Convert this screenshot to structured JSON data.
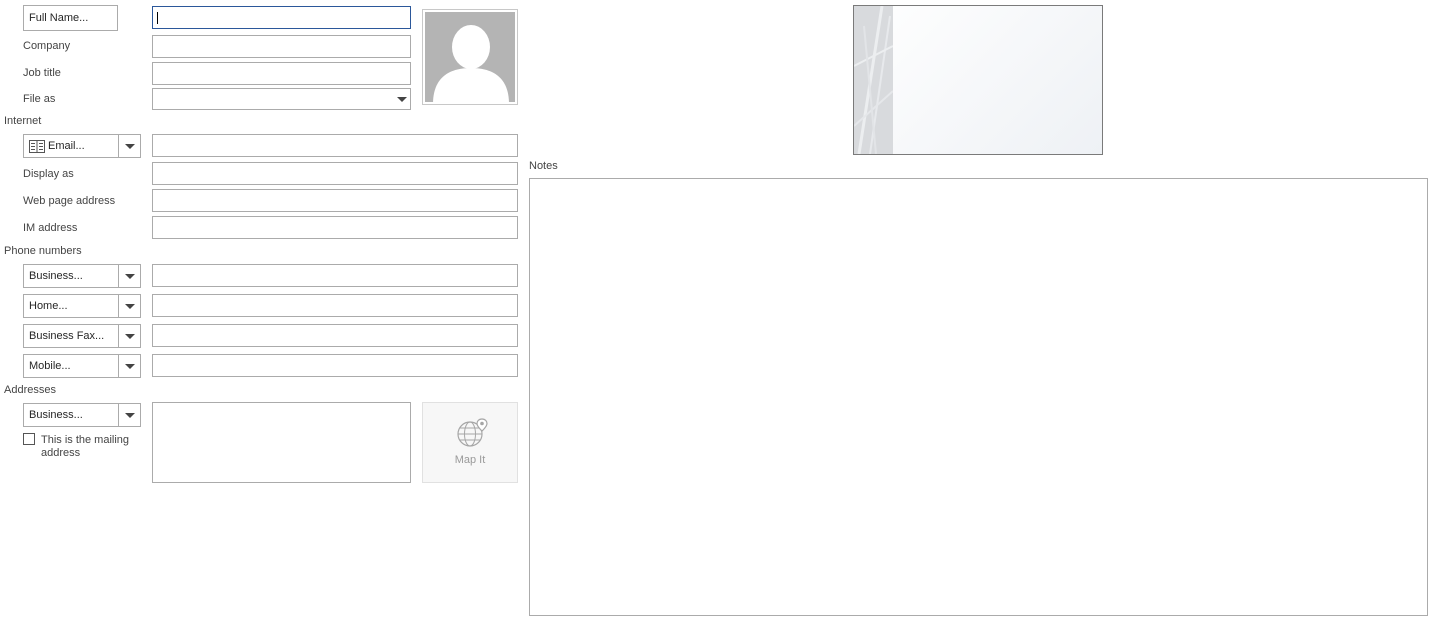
{
  "name_section": {
    "full_name_button": "Full Name...",
    "company_label": "Company",
    "job_title_label": "Job title",
    "file_as_label": "File as"
  },
  "internet": {
    "heading": "Internet",
    "email_button": "Email...",
    "display_as_label": "Display as",
    "web_page_label": "Web page address",
    "im_label": "IM address"
  },
  "phone": {
    "heading": "Phone numbers",
    "buttons": [
      "Business...",
      "Home...",
      "Business Fax...",
      "Mobile..."
    ]
  },
  "addresses": {
    "heading": "Addresses",
    "type_button": "Business...",
    "mailing_checkbox_label": "This is the mailing address",
    "mailing_checked": false,
    "map_it_label": "Map It"
  },
  "notes": {
    "label": "Notes"
  },
  "icons": {
    "contact_photo": "person-silhouette-icon",
    "email": "address-book-icon",
    "map": "globe-pin-icon",
    "dropdown": "chevron-down-icon"
  },
  "colors": {
    "border": "#ababab",
    "focus_border": "#2b579a",
    "photo_bg": "#b4b4b4"
  }
}
